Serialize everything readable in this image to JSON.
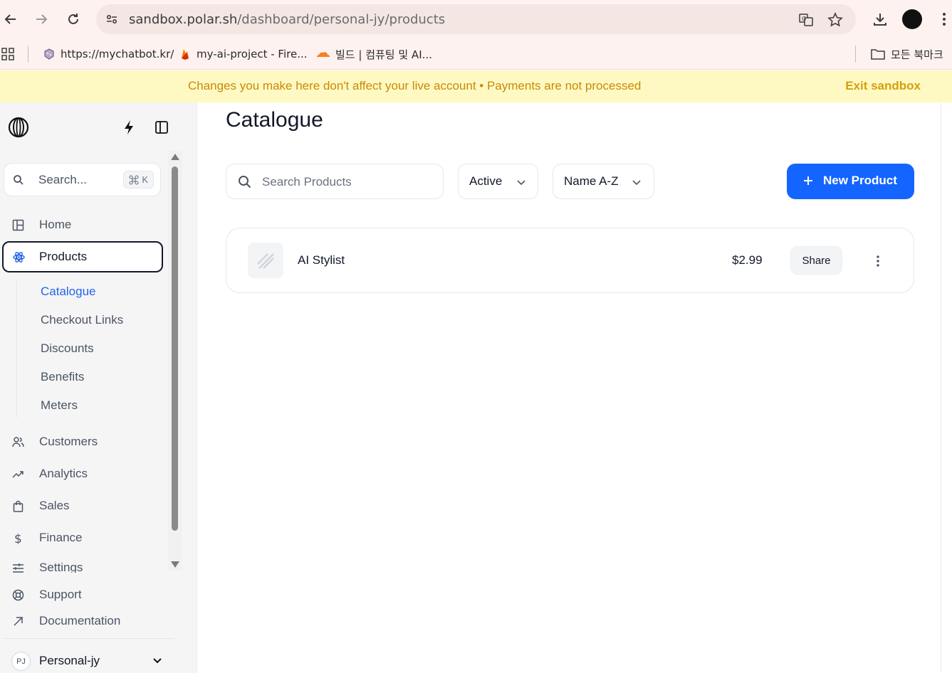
{
  "browser": {
    "url_host": "sandbox.polar.sh",
    "url_path": "/dashboard/personal-jy/products",
    "bookmarks": [
      {
        "label": "https://mychatbot.kr/",
        "icon": "dice-icon"
      },
      {
        "label": "my-ai-project - Fire...",
        "icon": "firebase-icon"
      },
      {
        "label": "빌드 | 컴퓨팅 및 AI...",
        "icon": "cloudflare-icon"
      }
    ],
    "all_bookmarks_label": "모든 북마크"
  },
  "banner": {
    "message": "Changes you make here don't affect your live account • Payments are not processed",
    "exit_label": "Exit sandbox"
  },
  "sidebar": {
    "search_label": "Search...",
    "search_shortcut": "K",
    "nav": {
      "home": "Home",
      "products": "Products",
      "customers": "Customers",
      "analytics": "Analytics",
      "sales": "Sales",
      "finance": "Finance",
      "settings": "Settings",
      "support": "Support",
      "documentation": "Documentation"
    },
    "products_sub": [
      "Catalogue",
      "Checkout Links",
      "Discounts",
      "Benefits",
      "Meters"
    ],
    "account": {
      "initials": "PJ",
      "name": "Personal-jy"
    }
  },
  "main": {
    "title": "Catalogue",
    "search_placeholder": "Search Products",
    "status_filter": "Active",
    "sort_filter": "Name A-Z",
    "new_product_label": "New Product",
    "products": [
      {
        "name": "AI Stylist",
        "price": "$2.99",
        "share_label": "Share"
      }
    ]
  },
  "colors": {
    "accent": "#1465ff",
    "active_link": "#2563eb",
    "banner_bg": "#fef9c3",
    "banner_text": "#ca8a04"
  }
}
